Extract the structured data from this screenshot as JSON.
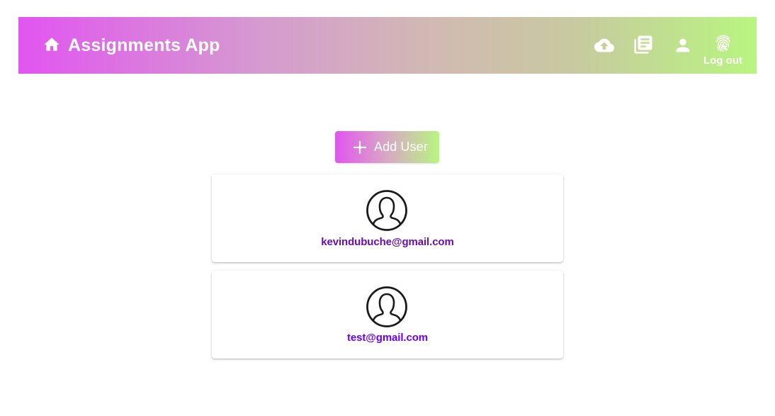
{
  "header": {
    "title": "Assignments App",
    "icons": [
      "home-icon",
      "cloud-upload-icon",
      "library-books-icon",
      "person-icon",
      "fingerprint-icon"
    ],
    "logout_label": "Log out"
  },
  "main": {
    "add_user_label": "Add User",
    "users": [
      {
        "email": "kevindubuche@gmail.com",
        "email_color": "#6a0dad"
      },
      {
        "email": "test@gmail.com",
        "email_color": "#6a00f4"
      }
    ]
  },
  "colors": {
    "gradient_start": "#e155f0",
    "gradient_end": "#b8f580",
    "text_on_gradient": "#ffffff"
  }
}
